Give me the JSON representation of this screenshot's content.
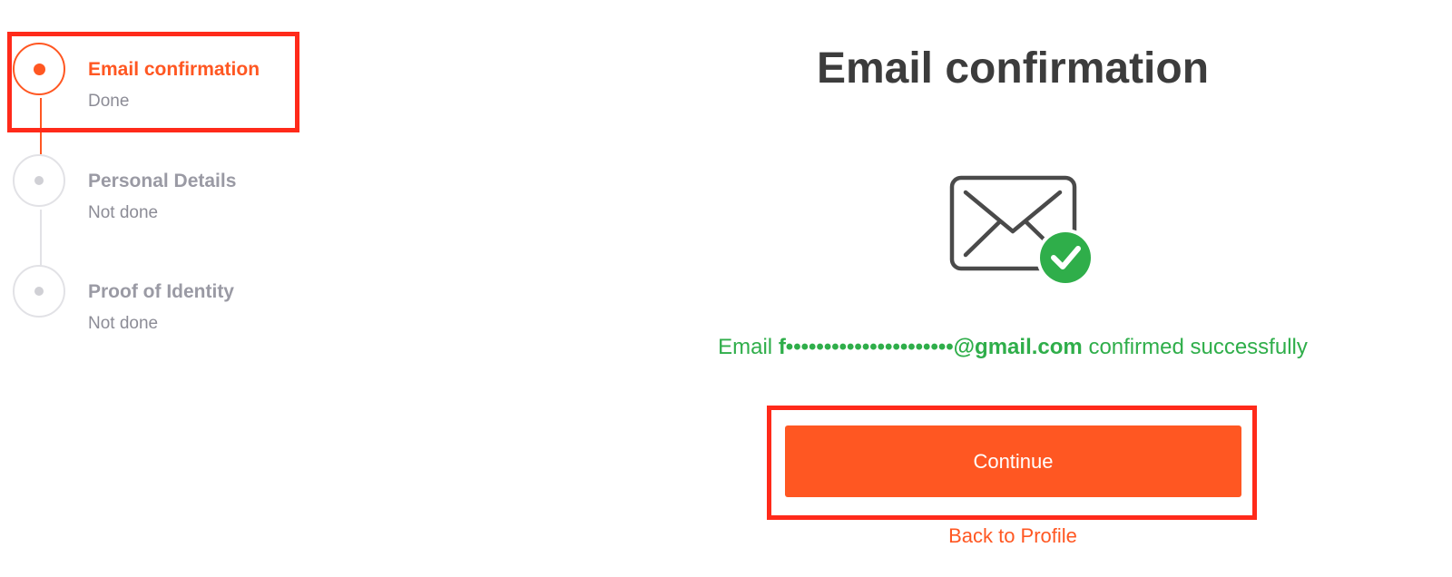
{
  "stepper": {
    "steps": [
      {
        "title": "Email confirmation",
        "status": "Done",
        "active": true
      },
      {
        "title": "Personal Details",
        "status": "Not done",
        "active": false
      },
      {
        "title": "Proof of Identity",
        "status": "Not done",
        "active": false
      }
    ]
  },
  "main": {
    "title": "Email confirmation",
    "icon": "mail-check-icon",
    "message": {
      "prefix": "Email",
      "email": "f••••••••••••••••••••••@gmail.com",
      "suffix": "confirmed successfully"
    },
    "continue_label": "Continue",
    "back_label": "Back to Profile"
  },
  "colors": {
    "accent": "#ff5722",
    "success": "#2fae4a",
    "highlight": "#ff2a1a",
    "title": "#3c3c3c",
    "muted": "#9a9aa4"
  }
}
